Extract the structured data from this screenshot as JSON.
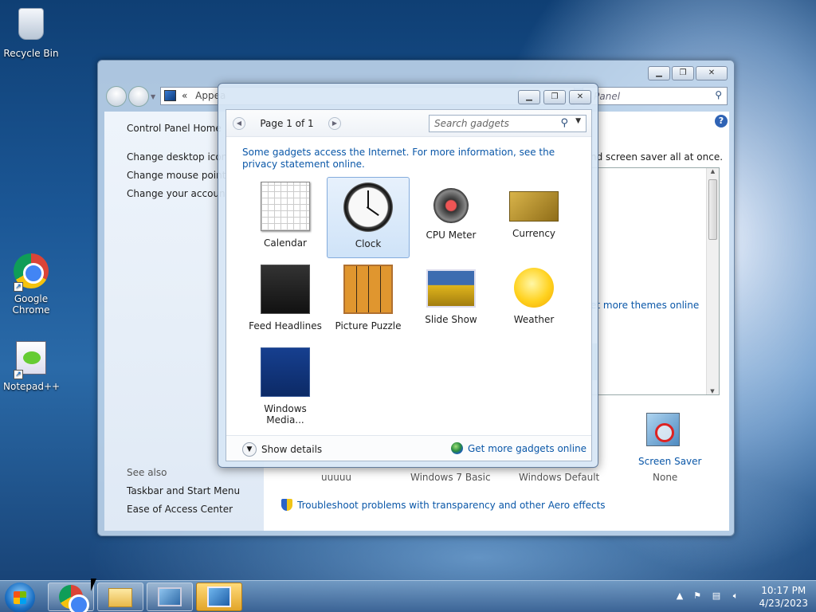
{
  "desktop": {
    "icons": [
      {
        "label": "Recycle Bin",
        "icon": "recycle-bin-icon"
      },
      {
        "label": "Google Chrome",
        "icon": "chrome-icon"
      },
      {
        "label": "Notepad++",
        "icon": "notepad-plus-plus-icon"
      }
    ]
  },
  "control_panel": {
    "address": "Appea",
    "address_prefix": "«",
    "search_placeholder": "l Panel",
    "left_links": [
      "Control Panel Home",
      "Change desktop icons",
      "Change mouse pointe",
      "Change your account"
    ],
    "see_also_label": "See also",
    "see_also": [
      "Taskbar and Start Menu",
      "Ease of Access Center"
    ],
    "intro_text": "nd screen saver all at once.",
    "more_themes": "et more themes online",
    "themes": [
      "uuuuu",
      "Windows 7 Basic",
      "Windows Default"
    ],
    "screen_saver_label": "Screen Saver",
    "screen_saver_value": "None",
    "troubleshoot": "Troubleshoot problems with transparency and other Aero effects"
  },
  "gadgets": {
    "pager": "Page 1 of 1",
    "search_placeholder": "Search gadgets",
    "notice": "Some gadgets access the Internet.  For more information, see the privacy statement online.",
    "items": [
      {
        "label": "Calendar",
        "icon": "calendar-icon",
        "selected": false
      },
      {
        "label": "Clock",
        "icon": "clock-icon",
        "selected": true
      },
      {
        "label": "CPU Meter",
        "icon": "cpu-meter-icon",
        "selected": false
      },
      {
        "label": "Currency",
        "icon": "currency-icon",
        "selected": false
      },
      {
        "label": "Feed Headlines",
        "icon": "feed-headlines-icon",
        "selected": false
      },
      {
        "label": "Picture Puzzle",
        "icon": "picture-puzzle-icon",
        "selected": false
      },
      {
        "label": "Slide Show",
        "icon": "slide-show-icon",
        "selected": false
      },
      {
        "label": "Weather",
        "icon": "weather-icon",
        "selected": false
      },
      {
        "label": "Windows Media...",
        "icon": "windows-media-center-icon",
        "selected": false
      }
    ],
    "show_details": "Show details",
    "get_more": "Get more gadgets online"
  },
  "taskbar": {
    "time": "10:17 PM",
    "date": "4/23/2023"
  }
}
